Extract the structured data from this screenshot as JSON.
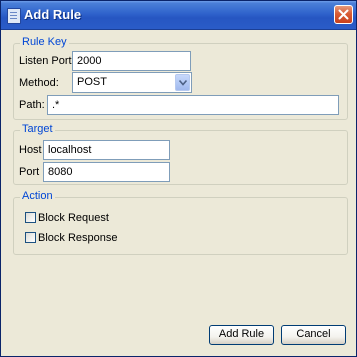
{
  "window": {
    "title": "Add Rule"
  },
  "rule_key": {
    "legend": "Rule Key",
    "listen_port_label": "Listen Port:",
    "listen_port_value": "2000",
    "method_label": "Method:",
    "method_value": "POST",
    "path_label": "Path:",
    "path_value": ".*"
  },
  "target": {
    "legend": "Target",
    "host_label": "Host",
    "host_value": "localhost",
    "port_label": "Port",
    "port_value": "8080"
  },
  "action": {
    "legend": "Action",
    "block_request_label": "Block Request",
    "block_response_label": "Block Response",
    "block_request_checked": false,
    "block_response_checked": false
  },
  "buttons": {
    "add_rule": "Add Rule",
    "cancel": "Cancel"
  },
  "icons": {
    "window": "window-icon",
    "close": "close-icon",
    "dropdown": "chevron-down-icon"
  },
  "colors": {
    "title_bar": "#2656c2",
    "group_title": "#0046d5",
    "close_button": "#d95c35"
  }
}
